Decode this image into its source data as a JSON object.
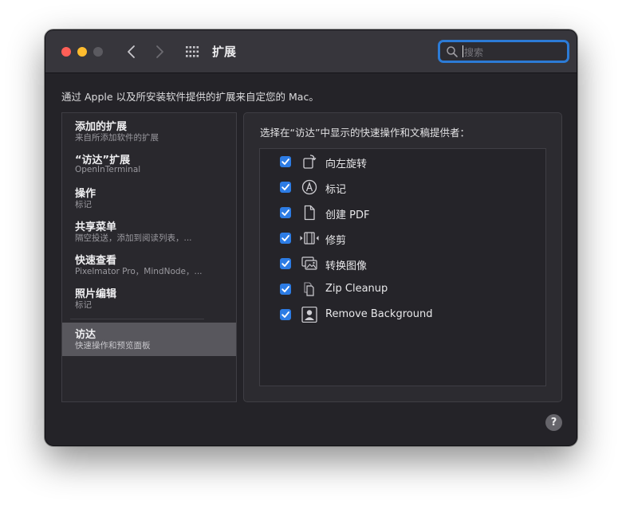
{
  "titlebar": {
    "title": "扩展",
    "search_placeholder": "搜索"
  },
  "description": "通过 Apple 以及所安装软件提供的扩展来自定您的 Mac。",
  "sidebar": {
    "items": [
      {
        "title": "添加的扩展",
        "subtitle": "来自所添加软件的扩展"
      },
      {
        "title": "“访达”扩展",
        "subtitle": "OpenInTerminal"
      },
      {
        "title": "操作",
        "subtitle": "标记"
      },
      {
        "title": "共享菜单",
        "subtitle": "隔空投送，添加到阅读列表，..."
      },
      {
        "title": "快速查看",
        "subtitle": "Pixelmator Pro，MindNode，..."
      },
      {
        "title": "照片编辑",
        "subtitle": "标记"
      },
      {
        "title": "访达",
        "subtitle": "快速操作和预览面板"
      }
    ],
    "selected_index": 6
  },
  "panel": {
    "title": "选择在“访达”中显示的快速操作和文稿提供者：",
    "items": [
      {
        "label": "向左旋转",
        "checked": true,
        "icon": "rotate-left-icon"
      },
      {
        "label": "标记",
        "checked": true,
        "icon": "markup-icon"
      },
      {
        "label": "创建 PDF",
        "checked": true,
        "icon": "document-icon"
      },
      {
        "label": "修剪",
        "checked": true,
        "icon": "trim-icon"
      },
      {
        "label": "转换图像",
        "checked": true,
        "icon": "convert-image-icon"
      },
      {
        "label": "Zip Cleanup",
        "checked": true,
        "icon": "documents-icon"
      },
      {
        "label": "Remove Background",
        "checked": true,
        "icon": "person-portrait-icon"
      }
    ]
  },
  "help_label": "?",
  "colors": {
    "accent": "#2d7ce4",
    "window_bg": "#242328",
    "titlebar_bg": "#37363c",
    "selected_row": "#58575d"
  }
}
